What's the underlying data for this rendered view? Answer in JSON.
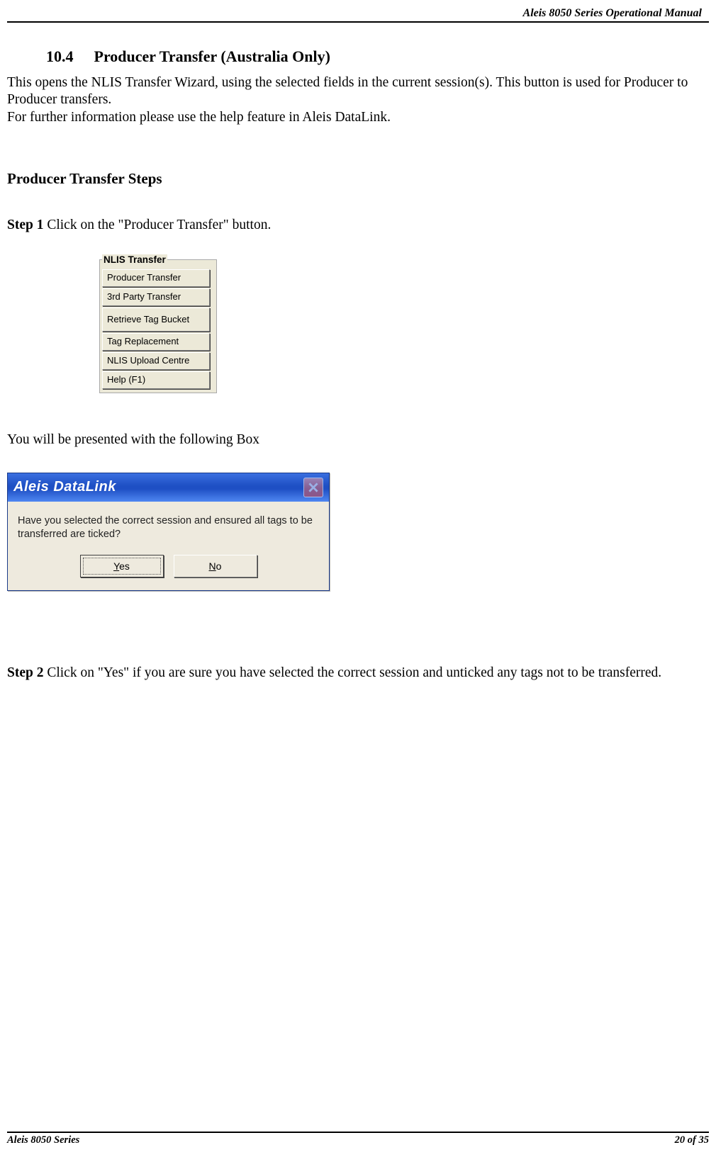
{
  "header": {
    "right": "Aleis 8050 Series Operational Manual"
  },
  "section": {
    "number": "10.4",
    "title": "Producer Transfer (Australia Only)"
  },
  "intro": {
    "p1": "This opens the NLIS Transfer Wizard, using the selected fields in the current session(s). This button is used for Producer to Producer transfers.",
    "p2": "For further information please use the help feature in Aleis DataLink."
  },
  "subheading": "Producer Transfer Steps",
  "step1": {
    "label": "Step 1",
    "text": " Click on the \"Producer Transfer\" button."
  },
  "nlis": {
    "legend": "NLIS Transfer",
    "buttons": [
      "Producer Transfer",
      "3rd Party Transfer",
      "Retrieve Tag Bucket",
      "Tag Replacement",
      "NLIS Upload Centre",
      "Help (F1)"
    ]
  },
  "mid_text": "You will be presented with the following Box",
  "dialog": {
    "title": "Aleis DataLink",
    "message": "Have you selected the correct session and ensured all tags to be transferred are ticked?",
    "yes_u": "Y",
    "yes_rest": "es",
    "no_u": "N",
    "no_rest": "o"
  },
  "step2": {
    "label": "Step 2",
    "text": " Click on \"Yes\" if you are sure you have selected the correct session and unticked any tags not to be transferred."
  },
  "footer": {
    "left": "Aleis 8050 Series",
    "right": "20 of 35"
  }
}
